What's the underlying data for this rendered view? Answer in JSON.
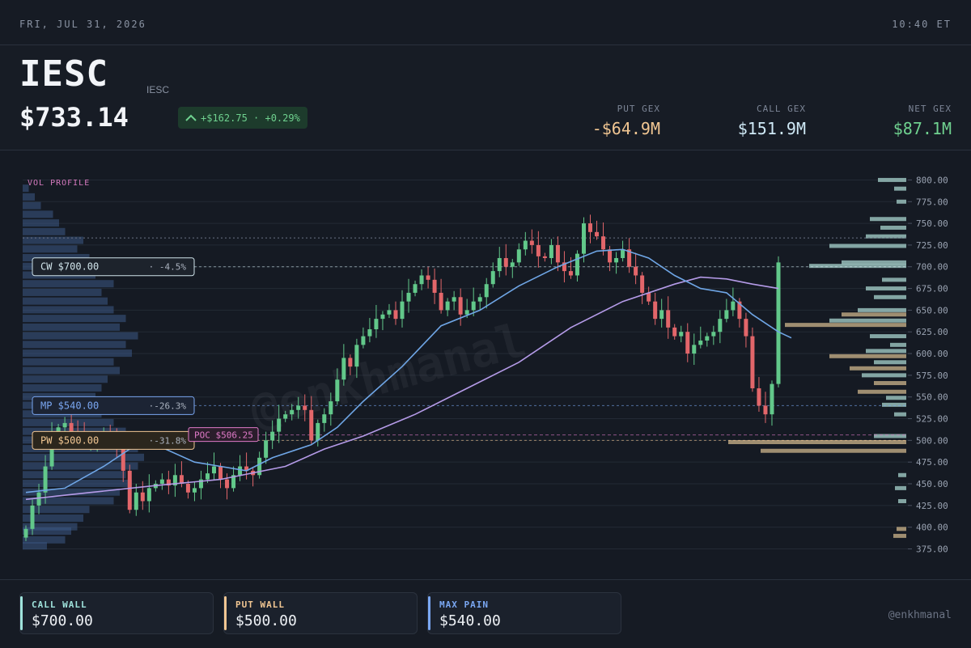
{
  "date_label": "FRI, JUL 31, 2026",
  "time_label": "10:40 ET",
  "ticker": "IESC",
  "subticker": "IESC",
  "price": "$733.14",
  "change": "+$162.75 · +0.29%",
  "gex": [
    {
      "label": "PUT GEX",
      "value": "-$64.9M",
      "color": "#f1c692"
    },
    {
      "label": "CALL GEX",
      "value": "$151.9M",
      "color": "#cfe9f6"
    },
    {
      "label": "NET GEX",
      "value": "$87.1M",
      "color": "#6fd18f"
    }
  ],
  "footer": {
    "cards": [
      {
        "label": "CALL WALL",
        "value": "$700.00",
        "color": "#9fe3dc"
      },
      {
        "label": "PUT WALL",
        "value": "$500.00",
        "color": "#f1c692"
      },
      {
        "label": "MAX PAIN",
        "value": "$540.00",
        "color": "#7aa7f2"
      }
    ],
    "handle": "@enkhmanal"
  },
  "chart_data": {
    "type": "candlestick",
    "ylim": [
      368,
      806
    ],
    "y_ticks": [
      "800.00",
      "775.00",
      "750.00",
      "725.00",
      "700.00",
      "675.00",
      "650.00",
      "625.00",
      "600.00",
      "575.00",
      "550.00",
      "525.00",
      "500.00",
      "475.00",
      "450.00",
      "425.00",
      "400.00",
      "375.00"
    ],
    "last_price": 733.14,
    "vol_profile_label": "VOL PROFILE",
    "watermark": "@enkhmanal",
    "levels": [
      {
        "name": "CW",
        "label": "CW $700.00",
        "pct": "· -4.5%",
        "value": 700,
        "color": "#cfe3ea"
      },
      {
        "name": "MP",
        "label": "MP $540.00",
        "pct": "·-26.3%",
        "value": 540,
        "color": "#7aa7f2"
      },
      {
        "name": "PW",
        "label": "PW $500.00",
        "pct": "·-31.8%",
        "value": 500,
        "color": "#f1c692"
      },
      {
        "name": "POC",
        "label": "POC $506.25",
        "value": 506.25,
        "color": "#e07ac8"
      }
    ],
    "closes": [
      398,
      425,
      440,
      470,
      505,
      515,
      520,
      510,
      505,
      498,
      500,
      502,
      505,
      498,
      490,
      465,
      420,
      440,
      430,
      445,
      450,
      455,
      448,
      460,
      450,
      440,
      445,
      455,
      462,
      470,
      455,
      445,
      460,
      470,
      465,
      460,
      480,
      500,
      510,
      525,
      530,
      535,
      540,
      535,
      500,
      520,
      530,
      545,
      570,
      595,
      585,
      610,
      620,
      628,
      640,
      645,
      650,
      640,
      660,
      670,
      680,
      690,
      685,
      670,
      650,
      660,
      665,
      645,
      650,
      660,
      665,
      680,
      695,
      710,
      700,
      705,
      720,
      730,
      725,
      712,
      710,
      725,
      705,
      695,
      690,
      715,
      750,
      740,
      735,
      720,
      705,
      710,
      720,
      700,
      690,
      670,
      660,
      640,
      650,
      630,
      620,
      625,
      600,
      610,
      615,
      620,
      625,
      640,
      650,
      660,
      640,
      620,
      560,
      540,
      530,
      565,
      705
    ],
    "ma_fast": [
      [
        0,
        440
      ],
      [
        6,
        445
      ],
      [
        12,
        470
      ],
      [
        16,
        490
      ],
      [
        20,
        495
      ],
      [
        26,
        475
      ],
      [
        30,
        470
      ],
      [
        34,
        465
      ],
      [
        38,
        480
      ],
      [
        44,
        495
      ],
      [
        48,
        515
      ],
      [
        52,
        545
      ],
      [
        58,
        585
      ],
      [
        64,
        632
      ],
      [
        70,
        650
      ],
      [
        76,
        678
      ],
      [
        82,
        700
      ],
      [
        88,
        718
      ],
      [
        92,
        720
      ],
      [
        96,
        710
      ],
      [
        100,
        690
      ],
      [
        104,
        675
      ],
      [
        108,
        670
      ],
      [
        112,
        645
      ],
      [
        116,
        625
      ],
      [
        118,
        618
      ]
    ],
    "ma_slow": [
      [
        0,
        432
      ],
      [
        10,
        440
      ],
      [
        20,
        448
      ],
      [
        30,
        455
      ],
      [
        40,
        470
      ],
      [
        46,
        490
      ],
      [
        52,
        505
      ],
      [
        60,
        530
      ],
      [
        68,
        560
      ],
      [
        76,
        590
      ],
      [
        84,
        630
      ],
      [
        92,
        660
      ],
      [
        100,
        680
      ],
      [
        104,
        688
      ],
      [
        108,
        686
      ],
      [
        112,
        680
      ],
      [
        116,
        675
      ]
    ],
    "vol_profile_left": [
      378,
      385,
      395,
      400,
      410,
      420,
      430,
      440,
      450,
      460,
      470,
      480,
      490,
      500,
      510,
      520,
      530,
      540,
      550,
      560,
      570,
      580,
      590,
      600,
      610,
      620,
      630,
      640,
      650,
      660,
      670,
      680,
      690,
      700,
      710,
      720,
      730,
      740,
      750,
      760,
      770,
      780,
      790
    ],
    "vol_profile_left_vals": [
      0.2,
      0.35,
      0.4,
      0.45,
      0.5,
      0.55,
      0.75,
      0.8,
      0.9,
      0.85,
      0.95,
      1.0,
      0.95,
      0.9,
      0.85,
      0.75,
      0.65,
      0.7,
      0.6,
      0.65,
      0.7,
      0.8,
      0.75,
      0.9,
      0.85,
      0.95,
      0.8,
      0.85,
      0.75,
      0.7,
      0.65,
      0.75,
      0.6,
      0.5,
      0.55,
      0.45,
      0.5,
      0.35,
      0.3,
      0.25,
      0.15,
      0.1,
      0.05
    ],
    "gex_bars": [
      {
        "y": 800,
        "w": 35,
        "c": "#9fc8c3"
      },
      {
        "y": 790,
        "w": 15,
        "c": "#9fc8c3"
      },
      {
        "y": 775,
        "w": 12,
        "c": "#9fc8c3"
      },
      {
        "y": 755,
        "w": 45,
        "c": "#9fc8c3"
      },
      {
        "y": 745,
        "w": 32,
        "c": "#9fc8c3"
      },
      {
        "y": 735,
        "w": 50,
        "c": "#9fc8c3"
      },
      {
        "y": 724,
        "w": 95,
        "c": "#9fc8c3"
      },
      {
        "y": 705,
        "w": 80,
        "c": "#9fc8c3"
      },
      {
        "y": 701,
        "w": 120,
        "c": "#9fc8c3"
      },
      {
        "y": 685,
        "w": 30,
        "c": "#9fc8c3"
      },
      {
        "y": 675,
        "w": 50,
        "c": "#9fc8c3"
      },
      {
        "y": 665,
        "w": 40,
        "c": "#9fc8c3"
      },
      {
        "y": 650,
        "w": 60,
        "c": "#9fc8c3"
      },
      {
        "y": 645,
        "w": 80,
        "c": "#c2ab84"
      },
      {
        "y": 638,
        "w": 95,
        "c": "#9fc8c3"
      },
      {
        "y": 633,
        "w": 150,
        "c": "#c2ab84"
      },
      {
        "y": 620,
        "w": 45,
        "c": "#9fc8c3"
      },
      {
        "y": 610,
        "w": 20,
        "c": "#9fc8c3"
      },
      {
        "y": 603,
        "w": 50,
        "c": "#9fc8c3"
      },
      {
        "y": 597,
        "w": 95,
        "c": "#c2ab84"
      },
      {
        "y": 590,
        "w": 40,
        "c": "#9fc8c3"
      },
      {
        "y": 583,
        "w": 70,
        "c": "#c2ab84"
      },
      {
        "y": 575,
        "w": 55,
        "c": "#9fc8c3"
      },
      {
        "y": 566,
        "w": 40,
        "c": "#c2ab84"
      },
      {
        "y": 556,
        "w": 60,
        "c": "#c2ab84"
      },
      {
        "y": 549,
        "w": 25,
        "c": "#9fc8c3"
      },
      {
        "y": 541,
        "w": 30,
        "c": "#9fc8c3"
      },
      {
        "y": 530,
        "w": 15,
        "c": "#9fc8c3"
      },
      {
        "y": 505,
        "w": 40,
        "c": "#9fc8c3"
      },
      {
        "y": 498,
        "w": 220,
        "c": "#c2ab84"
      },
      {
        "y": 488,
        "w": 180,
        "c": "#c2ab84"
      },
      {
        "y": 460,
        "w": 10,
        "c": "#9fc8c3"
      },
      {
        "y": 445,
        "w": 14,
        "c": "#9fc8c3"
      },
      {
        "y": 430,
        "w": 10,
        "c": "#9fc8c3"
      },
      {
        "y": 398,
        "w": 12,
        "c": "#c2ab84"
      },
      {
        "y": 390,
        "w": 16,
        "c": "#c2ab84"
      }
    ]
  }
}
